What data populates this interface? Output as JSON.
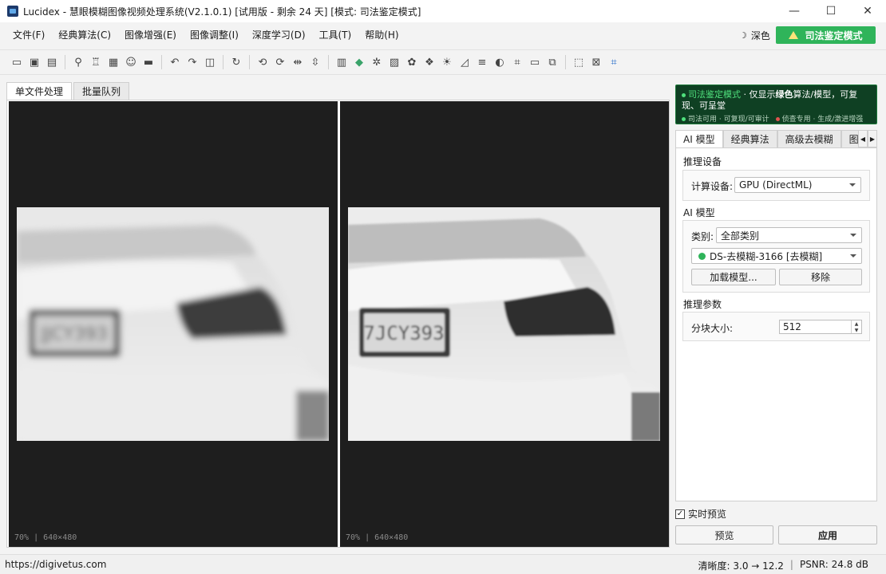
{
  "window": {
    "title": "Lucidex - 慧眼模糊图像视频处理系统(V2.1.0.1)  [试用版 - 剩余 24 天]  [模式: 司法鉴定模式]",
    "controls": [
      "—",
      "☐",
      "✕"
    ]
  },
  "menu": {
    "items": [
      "文件(F)",
      "经典算法(C)",
      "图像增强(E)",
      "图像调整(I)",
      "深度学习(D)",
      "工具(T)",
      "帮助(H)"
    ],
    "theme_label": "深色",
    "forensic_button": "司法鉴定模式",
    "colors": {
      "forensic_button": "#2fb45a"
    }
  },
  "toolbar": {
    "groups": [
      [
        "folder-open-icon",
        "folder-video-icon",
        "save-icon"
      ],
      [
        "magic-wand-icon",
        "trophy-icon",
        "plate-icon",
        "face-icon",
        "keyboard-icon"
      ],
      [
        "undo-icon",
        "redo-icon",
        "compare-icon"
      ],
      [
        "rotate-icon"
      ],
      [
        "rotate-left-icon",
        "rotate-right-icon",
        "flip-horizontal-icon",
        "flip-vertical-icon"
      ],
      [
        "histogram-icon",
        "color-icon",
        "brightness-icon",
        "image-icon",
        "denoise-icon",
        "channels-icon",
        "sun-icon",
        "curves-icon",
        "levels-icon",
        "contrast-icon",
        "crop-icon",
        "aspect-icon",
        "layers-icon"
      ],
      [
        "select-rect-icon",
        "clear-select-icon",
        "crop-blue-icon"
      ]
    ]
  },
  "left_tabs": [
    "单文件处理",
    "批量队列"
  ],
  "viewer": {
    "left_info": "70% | 640×480",
    "right_info": "70% | 640×480",
    "left_plate": "JJCY393",
    "right_plate": "7JCY393"
  },
  "mode_banner": {
    "title": "司法鉴定模式",
    "desc_prefix": "· 仅显示",
    "desc_bold": "绿色",
    "desc_suffix": "算法/模型，可复现、可呈堂",
    "legend_green": "司法可用 · 可复现/可审计",
    "legend_red": "侦查专用 · 生成/激进增强",
    "colors": {
      "green": "#4fe07c",
      "red": "#e0544f",
      "bg": "#0f4023"
    }
  },
  "right_tabs": [
    "AI 模型",
    "经典算法",
    "高级去模糊",
    "图像"
  ],
  "right_panel": {
    "inference_device_title": "推理设备",
    "compute_device_label": "计算设备:",
    "compute_device_value": "GPU (DirectML)",
    "ai_model_title": "AI 模型",
    "category_label": "类别:",
    "category_value": "全部类别",
    "model_value": "DS-去模糊-3166 [去模糊]",
    "load_model_button": "加载模型...",
    "remove_button": "移除",
    "inference_params_title": "推理参数",
    "tile_size_label": "分块大小:",
    "tile_size_value": "512"
  },
  "bottom": {
    "live_preview_label": "实时预览",
    "live_preview_checked": "✓",
    "preview_button": "预览",
    "apply_button": "应用"
  },
  "status": {
    "url": "https://digivetus.com",
    "clarity": "清晰度: 3.0 → 12.2",
    "separator": "|",
    "psnr": "PSNR: 24.8 dB"
  }
}
